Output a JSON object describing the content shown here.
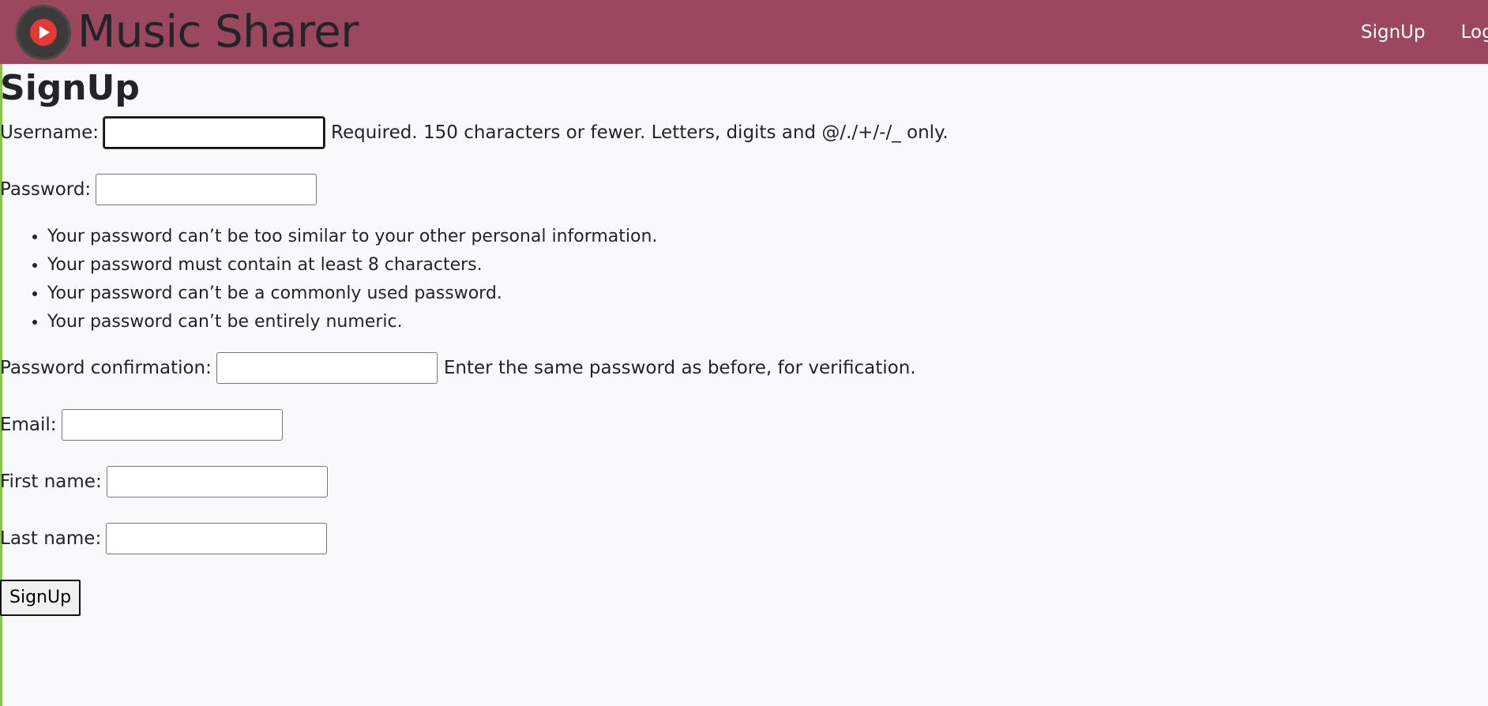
{
  "nav": {
    "brand": "Music Sharer",
    "links": [
      "SignUp",
      "Log"
    ]
  },
  "page": {
    "title": "SignUp"
  },
  "form": {
    "username": {
      "label": "Username:",
      "value": "",
      "help": "Required. 150 characters or fewer. Letters, digits and @/./+/-/_ only."
    },
    "password": {
      "label": "Password:",
      "value": "",
      "rules": [
        "Your password can’t be too similar to your other personal information.",
        "Your password must contain at least 8 characters.",
        "Your password can’t be a commonly used password.",
        "Your password can’t be entirely numeric."
      ]
    },
    "password_confirmation": {
      "label": "Password confirmation:",
      "value": "",
      "help": "Enter the same password as before, for verification."
    },
    "email": {
      "label": "Email:",
      "value": ""
    },
    "first_name": {
      "label": "First name:",
      "value": ""
    },
    "last_name": {
      "label": "Last name:",
      "value": ""
    },
    "submit_label": "SignUp"
  },
  "colors": {
    "navbar": "#9b475e",
    "accent_left": "#8bc34a",
    "background": "#f8f9fb"
  },
  "icons": {
    "logo": "play-circle-icon"
  }
}
